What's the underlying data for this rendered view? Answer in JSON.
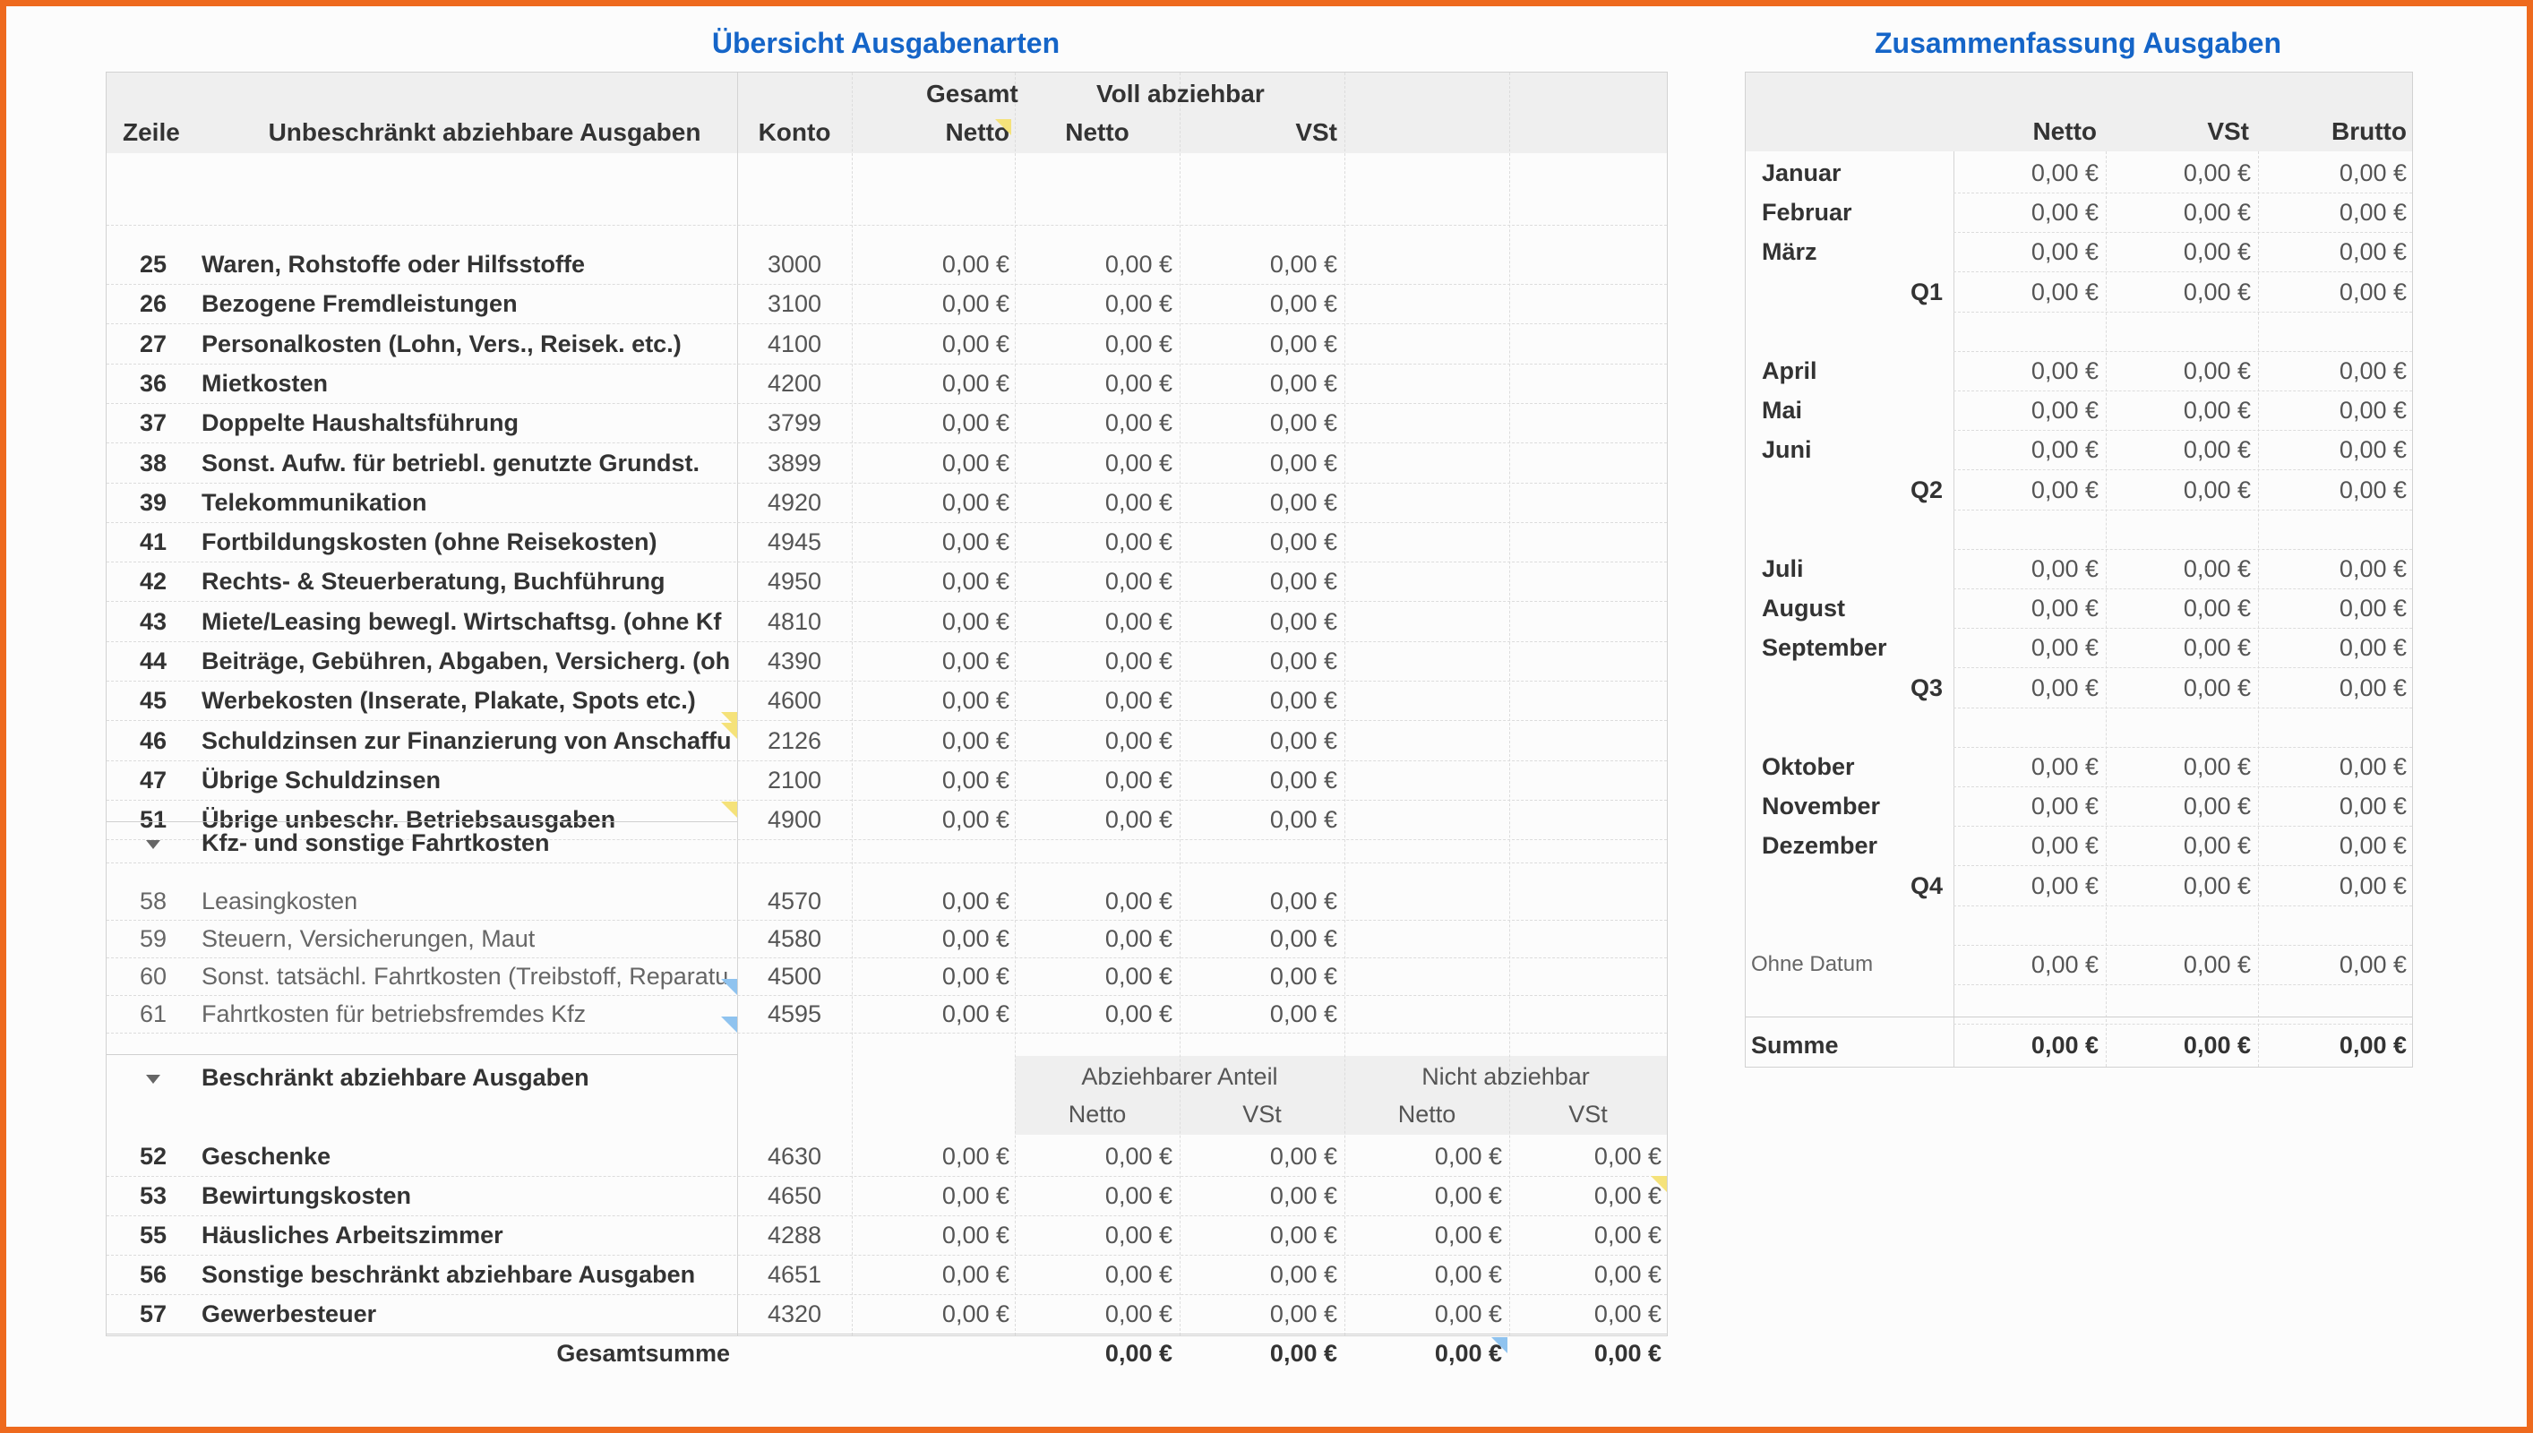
{
  "left": {
    "title": "Übersicht Ausgabenarten",
    "headers": {
      "zeile": "Zeile",
      "category": "Unbeschränkt abziehbare Ausgaben",
      "konto": "Konto",
      "gesamt": "Gesamt",
      "gesamt_netto": "Netto",
      "voll": "Voll abziehbar",
      "voll_netto": "Netto",
      "voll_vst": "VSt"
    },
    "rows": [
      {
        "zeile": "25",
        "name": "Waren, Rohstoffe oder Hilfsstoffe",
        "konto": "3000",
        "gesamt": "0,00 €",
        "netto": "0,00 €",
        "vst": "0,00 €"
      },
      {
        "zeile": "26",
        "name": "Bezogene Fremdleistungen",
        "konto": "3100",
        "gesamt": "0,00 €",
        "netto": "0,00 €",
        "vst": "0,00 €"
      },
      {
        "zeile": "27",
        "name": "Personalkosten (Lohn, Vers., Reisek. etc.)",
        "konto": "4100",
        "gesamt": "0,00 €",
        "netto": "0,00 €",
        "vst": "0,00 €"
      },
      {
        "zeile": "36",
        "name": "Mietkosten",
        "konto": "4200",
        "gesamt": "0,00 €",
        "netto": "0,00 €",
        "vst": "0,00 €"
      },
      {
        "zeile": "37",
        "name": "Doppelte Haushaltsführung",
        "konto": "3799",
        "gesamt": "0,00 €",
        "netto": "0,00 €",
        "vst": "0,00 €"
      },
      {
        "zeile": "38",
        "name": "Sonst. Aufw. für betriebl. genutzte Grundst.",
        "konto": "3899",
        "gesamt": "0,00 €",
        "netto": "0,00 €",
        "vst": "0,00 €"
      },
      {
        "zeile": "39",
        "name": "Telekommunikation",
        "konto": "4920",
        "gesamt": "0,00 €",
        "netto": "0,00 €",
        "vst": "0,00 €"
      },
      {
        "zeile": "41",
        "name": "Fortbildungskosten (ohne Reisekosten)",
        "konto": "4945",
        "gesamt": "0,00 €",
        "netto": "0,00 €",
        "vst": "0,00 €"
      },
      {
        "zeile": "42",
        "name": "Rechts- & Steuerberatung, Buchführung",
        "konto": "4950",
        "gesamt": "0,00 €",
        "netto": "0,00 €",
        "vst": "0,00 €"
      },
      {
        "zeile": "43",
        "name": "Miete/Leasing bewegl. Wirtschaftsg. (ohne Kf",
        "konto": "4810",
        "gesamt": "0,00 €",
        "netto": "0,00 €",
        "vst": "0,00 €"
      },
      {
        "zeile": "44",
        "name": "Beiträge, Gebühren, Abgaben, Versicherg. (oh",
        "konto": "4390",
        "gesamt": "0,00 €",
        "netto": "0,00 €",
        "vst": "0,00 €"
      },
      {
        "zeile": "45",
        "name": "Werbekosten (Inserate, Plakate, Spots etc.)",
        "konto": "4600",
        "gesamt": "0,00 €",
        "netto": "0,00 €",
        "vst": "0,00 €"
      },
      {
        "zeile": "46",
        "name": "Schuldzinsen zur Finanzierung von Anschaffu",
        "konto": "2126",
        "gesamt": "0,00 €",
        "netto": "0,00 €",
        "vst": "0,00 €"
      },
      {
        "zeile": "47",
        "name": "Übrige Schuldzinsen",
        "konto": "2100",
        "gesamt": "0,00 €",
        "netto": "0,00 €",
        "vst": "0,00 €"
      },
      {
        "zeile": "51",
        "name": "Übrige unbeschr. Betriebsausgaben",
        "konto": "4900",
        "gesamt": "0,00 €",
        "netto": "0,00 €",
        "vst": "0,00 €"
      }
    ],
    "kfz": {
      "title": "Kfz- und sonstige Fahrtkosten",
      "rows": [
        {
          "zeile": "58",
          "name": "Leasingkosten",
          "konto": "4570",
          "gesamt": "0,00 €",
          "netto": "0,00 €",
          "vst": "0,00 €"
        },
        {
          "zeile": "59",
          "name": "Steuern, Versicherungen, Maut",
          "konto": "4580",
          "gesamt": "0,00 €",
          "netto": "0,00 €",
          "vst": "0,00 €"
        },
        {
          "zeile": "60",
          "name": "Sonst. tatsächl. Fahrtkosten (Treibstoff, Reparatu",
          "konto": "4500",
          "gesamt": "0,00 €",
          "netto": "0,00 €",
          "vst": "0,00 €"
        },
        {
          "zeile": "61",
          "name": "Fahrtkosten für betriebsfremdes Kfz",
          "konto": "4595",
          "gesamt": "0,00 €",
          "netto": "0,00 €",
          "vst": "0,00 €"
        }
      ]
    },
    "beschraenkt": {
      "title": "Beschränkt abziehbare Ausgaben",
      "abziehbar": "Abziehbarer Anteil",
      "nicht": "Nicht abziehbar",
      "netto": "Netto",
      "vst": "VSt",
      "rows": [
        {
          "zeile": "52",
          "name": "Geschenke",
          "konto": "4630",
          "gesamt": "0,00 €",
          "a_netto": "0,00 €",
          "a_vst": "0,00 €",
          "n_netto": "0,00 €",
          "n_vst": "0,00 €"
        },
        {
          "zeile": "53",
          "name": "Bewirtungskosten",
          "konto": "4650",
          "gesamt": "0,00 €",
          "a_netto": "0,00 €",
          "a_vst": "0,00 €",
          "n_netto": "0,00 €",
          "n_vst": "0,00 €"
        },
        {
          "zeile": "55",
          "name": "Häusliches Arbeitszimmer",
          "konto": "4288",
          "gesamt": "0,00 €",
          "a_netto": "0,00 €",
          "a_vst": "0,00 €",
          "n_netto": "0,00 €",
          "n_vst": "0,00 €"
        },
        {
          "zeile": "56",
          "name": "Sonstige beschränkt abziehbare Ausgaben",
          "konto": "4651",
          "gesamt": "0,00 €",
          "a_netto": "0,00 €",
          "a_vst": "0,00 €",
          "n_netto": "0,00 €",
          "n_vst": "0,00 €"
        },
        {
          "zeile": "57",
          "name": "Gewerbesteuer",
          "konto": "4320",
          "gesamt": "0,00 €",
          "a_netto": "0,00 €",
          "a_vst": "0,00 €",
          "n_netto": "0,00 €",
          "n_vst": "0,00 €"
        }
      ]
    },
    "total": {
      "label": "Gesamtsumme",
      "a_netto": "0,00 €",
      "a_vst": "0,00 €",
      "n_netto": "0,00 €",
      "n_vst": "0,00 €"
    }
  },
  "right": {
    "title": "Zusammenfassung Ausgaben",
    "headers": {
      "netto": "Netto",
      "vst": "VSt",
      "brutto": "Brutto"
    },
    "rows": [
      {
        "label": "Januar",
        "type": "month",
        "netto": "0,00 €",
        "vst": "0,00 €",
        "brutto": "0,00 €"
      },
      {
        "label": "Februar",
        "type": "month",
        "netto": "0,00 €",
        "vst": "0,00 €",
        "brutto": "0,00 €"
      },
      {
        "label": "März",
        "type": "month",
        "netto": "0,00 €",
        "vst": "0,00 €",
        "brutto": "0,00 €"
      },
      {
        "label": "Q1",
        "type": "quarter",
        "netto": "0,00 €",
        "vst": "0,00 €",
        "brutto": "0,00 €"
      },
      {
        "label": "",
        "type": "blank"
      },
      {
        "label": "April",
        "type": "month",
        "netto": "0,00 €",
        "vst": "0,00 €",
        "brutto": "0,00 €"
      },
      {
        "label": "Mai",
        "type": "month",
        "netto": "0,00 €",
        "vst": "0,00 €",
        "brutto": "0,00 €"
      },
      {
        "label": "Juni",
        "type": "month",
        "netto": "0,00 €",
        "vst": "0,00 €",
        "brutto": "0,00 €"
      },
      {
        "label": "Q2",
        "type": "quarter",
        "netto": "0,00 €",
        "vst": "0,00 €",
        "brutto": "0,00 €"
      },
      {
        "label": "",
        "type": "blank"
      },
      {
        "label": "Juli",
        "type": "month",
        "netto": "0,00 €",
        "vst": "0,00 €",
        "brutto": "0,00 €"
      },
      {
        "label": "August",
        "type": "month",
        "netto": "0,00 €",
        "vst": "0,00 €",
        "brutto": "0,00 €"
      },
      {
        "label": "September",
        "type": "month",
        "netto": "0,00 €",
        "vst": "0,00 €",
        "brutto": "0,00 €"
      },
      {
        "label": "Q3",
        "type": "quarter",
        "netto": "0,00 €",
        "vst": "0,00 €",
        "brutto": "0,00 €"
      },
      {
        "label": "",
        "type": "blank"
      },
      {
        "label": "Oktober",
        "type": "month",
        "netto": "0,00 €",
        "vst": "0,00 €",
        "brutto": "0,00 €"
      },
      {
        "label": "November",
        "type": "month",
        "netto": "0,00 €",
        "vst": "0,00 €",
        "brutto": "0,00 €"
      },
      {
        "label": "Dezember",
        "type": "month",
        "netto": "0,00 €",
        "vst": "0,00 €",
        "brutto": "0,00 €"
      },
      {
        "label": "Q4",
        "type": "quarter",
        "netto": "0,00 €",
        "vst": "0,00 €",
        "brutto": "0,00 €"
      },
      {
        "label": "",
        "type": "blank"
      },
      {
        "label": "Ohne Datum",
        "type": "nodate",
        "netto": "0,00 €",
        "vst": "0,00 €",
        "brutto": "0,00 €"
      },
      {
        "label": "",
        "type": "blank"
      }
    ],
    "summe": {
      "label": "Summe",
      "netto": "0,00 €",
      "vst": "0,00 €",
      "brutto": "0,00 €"
    }
  },
  "colors": {
    "accent": "#1565c8",
    "frame": "#ee6a1e",
    "header_bg": "#efefef",
    "comment_yellow": "#f5e27a",
    "comment_blue": "#8fc3ef"
  }
}
